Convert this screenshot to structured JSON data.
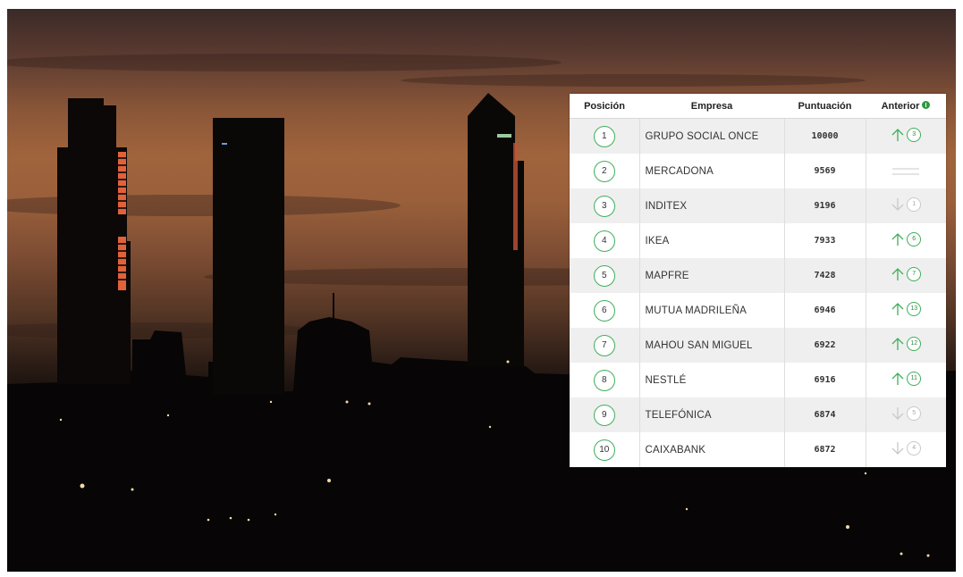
{
  "table": {
    "headers": {
      "position": "Posición",
      "company": "Empresa",
      "score": "Puntuación",
      "previous": "Anterior"
    },
    "rows": [
      {
        "pos": "1",
        "company": "GRUPO SOCIAL ONCE",
        "score": "10000",
        "trend": "up",
        "previous": "3"
      },
      {
        "pos": "2",
        "company": "MERCADONA",
        "score": "9569",
        "trend": "same",
        "previous": ""
      },
      {
        "pos": "3",
        "company": "INDITEX",
        "score": "9196",
        "trend": "down",
        "previous": "1"
      },
      {
        "pos": "4",
        "company": "IKEA",
        "score": "7933",
        "trend": "up",
        "previous": "6"
      },
      {
        "pos": "5",
        "company": "MAPFRE",
        "score": "7428",
        "trend": "up",
        "previous": "7"
      },
      {
        "pos": "6",
        "company": "MUTUA MADRILEÑA",
        "score": "6946",
        "trend": "up",
        "previous": "13"
      },
      {
        "pos": "7",
        "company": "MAHOU SAN MIGUEL",
        "score": "6922",
        "trend": "up",
        "previous": "12"
      },
      {
        "pos": "8",
        "company": "NESTLÉ",
        "score": "6916",
        "trend": "up",
        "previous": "11"
      },
      {
        "pos": "9",
        "company": "TELEFÓNICA",
        "score": "6874",
        "trend": "down",
        "previous": "5"
      },
      {
        "pos": "10",
        "company": "CAIXABANK",
        "score": "6872",
        "trend": "down",
        "previous": "4"
      }
    ]
  },
  "colors": {
    "accent_green": "#3fae5a",
    "info_green": "#2c9a3e",
    "down_gray": "#c9c9c9",
    "sky_orange": "#a0643c"
  },
  "icons": {
    "info": "info-icon",
    "up": "arrow-up-icon",
    "down": "arrow-down-icon",
    "same": "no-change-icon"
  }
}
